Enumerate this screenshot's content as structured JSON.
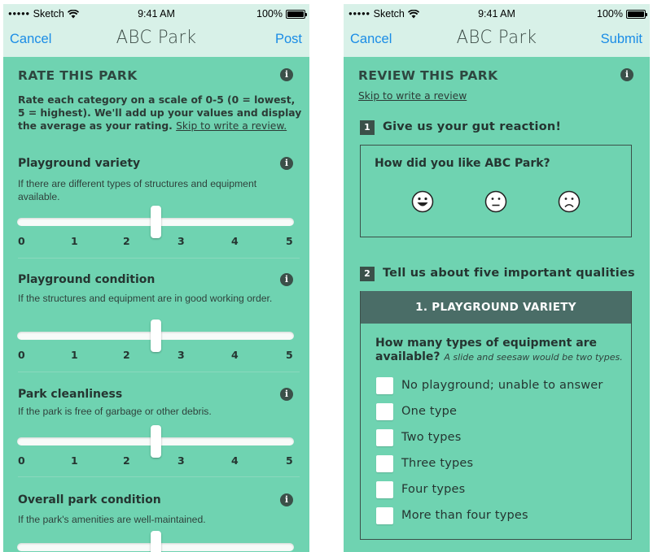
{
  "status_bar": {
    "carrier": "Sketch",
    "time": "9:41 AM",
    "battery": "100%"
  },
  "left_screen": {
    "nav": {
      "cancel": "Cancel",
      "title": "ABC Park",
      "action": "Post"
    },
    "section_title": "RATE THIS PARK",
    "intro_text": "Rate each category on a scale of 0-5 (0 = lowest, 5 = highest). We'll add up your values and display the average as your rating.",
    "skip_link": "Skip to write a review.",
    "tick_labels": [
      "0",
      "1",
      "2",
      "3",
      "4",
      "5"
    ],
    "categories": [
      {
        "title": "Playground variety",
        "description": "If there are different types of structures and equipment available.",
        "value": 2.5
      },
      {
        "title": "Playground condition",
        "description": "If the structures and equipment are in good working order.",
        "value": 2.5
      },
      {
        "title": "Park cleanliness",
        "description": "If the park is free of garbage or other debris.",
        "value": 2.5
      },
      {
        "title": "Overall park condition",
        "description": "If the park's amenities are well-maintained.",
        "value": 2.5
      }
    ]
  },
  "right_screen": {
    "nav": {
      "cancel": "Cancel",
      "title": "ABC Park",
      "action": "Submit"
    },
    "section_title": "REVIEW THIS PARK",
    "skip_link": "Skip to write a review",
    "step1": {
      "number": "1",
      "title": "Give us your gut reaction!",
      "question": "How did you like ABC Park?"
    },
    "step2": {
      "number": "2",
      "title": "Tell us about five important qualities"
    },
    "quality": {
      "header": "1.  PLAYGROUND VARIETY",
      "question": "How many types of equipment are available?",
      "hint": "A slide and seesaw would be two types.",
      "options": [
        "No playground; unable to answer",
        "One type",
        "Two types",
        "Three types",
        "Four types",
        "More than four types"
      ]
    }
  }
}
